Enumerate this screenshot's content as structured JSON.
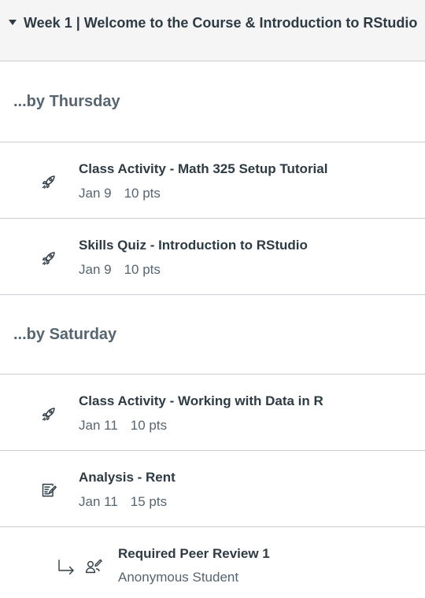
{
  "module": {
    "title": "Week 1 | Welcome to the Course & Introduction to RStudio"
  },
  "sections": [
    {
      "label": "...by Thursday",
      "items": [
        {
          "title": "Class Activity - Math 325 Setup Tutorial",
          "date": "Jan 9",
          "points": "10 pts",
          "icon": "rocket-icon"
        },
        {
          "title": "Skills Quiz - Introduction to RStudio",
          "date": "Jan 9",
          "points": "10 pts",
          "icon": "rocket-icon"
        }
      ]
    },
    {
      "label": "...by Saturday",
      "items": [
        {
          "title": "Class Activity - Working with Data in R",
          "date": "Jan 11",
          "points": "10 pts",
          "icon": "rocket-icon"
        },
        {
          "title": "Analysis - Rent",
          "date": "Jan 11",
          "points": "15 pts",
          "icon": "assignment-icon"
        }
      ]
    }
  ],
  "peer_review": {
    "title": "Required Peer Review 1",
    "subtitle": "Anonymous Student",
    "icons": [
      "return-arrow-icon",
      "peer-review-icon"
    ]
  }
}
